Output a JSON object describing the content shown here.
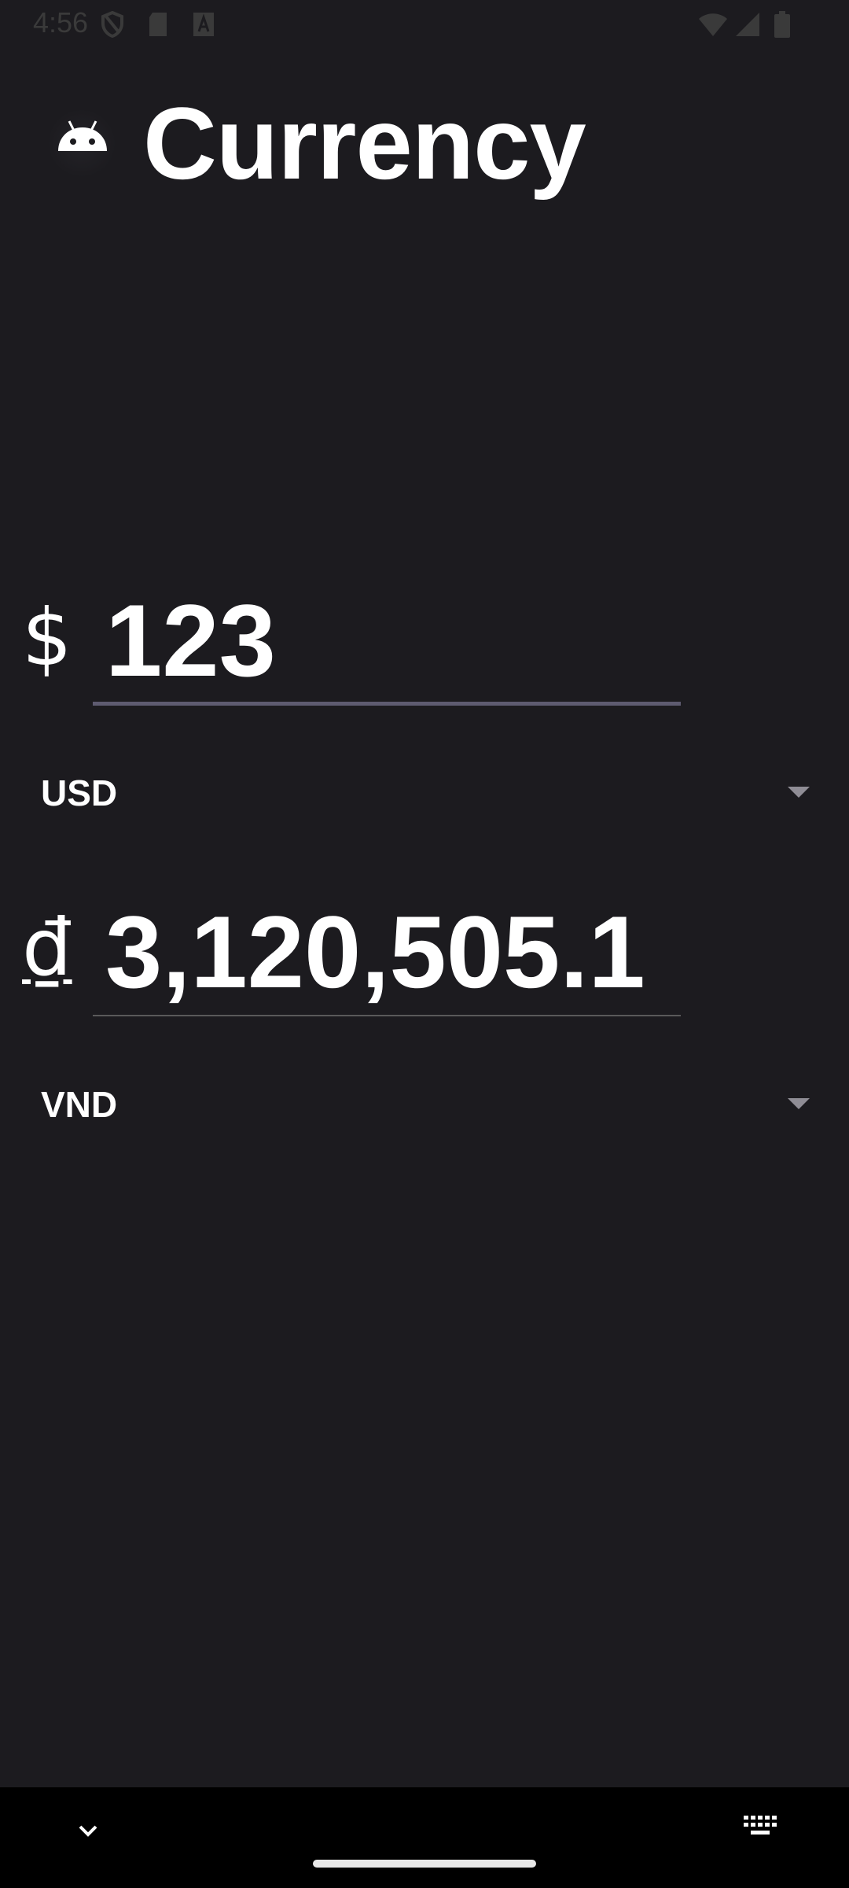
{
  "status_bar": {
    "time": "4:56",
    "icons_left": [
      "shield-icon",
      "sd-card-icon",
      "font-a-icon"
    ],
    "icons_right": [
      "wifi-icon",
      "cellular-signal-icon",
      "battery-icon"
    ]
  },
  "header": {
    "app_icon": "android-icon",
    "title": "Currency"
  },
  "source": {
    "symbol": "$",
    "amount": "123",
    "currency": "USD"
  },
  "target": {
    "symbol": "₫",
    "amount": "3,120,505.1",
    "currency": "VND"
  },
  "navigation": {
    "left_icon": "chevron-down-icon",
    "right_icon": "keyboard-icon"
  },
  "colors": {
    "background": "#1c1b1f",
    "text": "#ffffff",
    "focus_underline": "#5e5b70",
    "nav_bar": "#000000"
  }
}
